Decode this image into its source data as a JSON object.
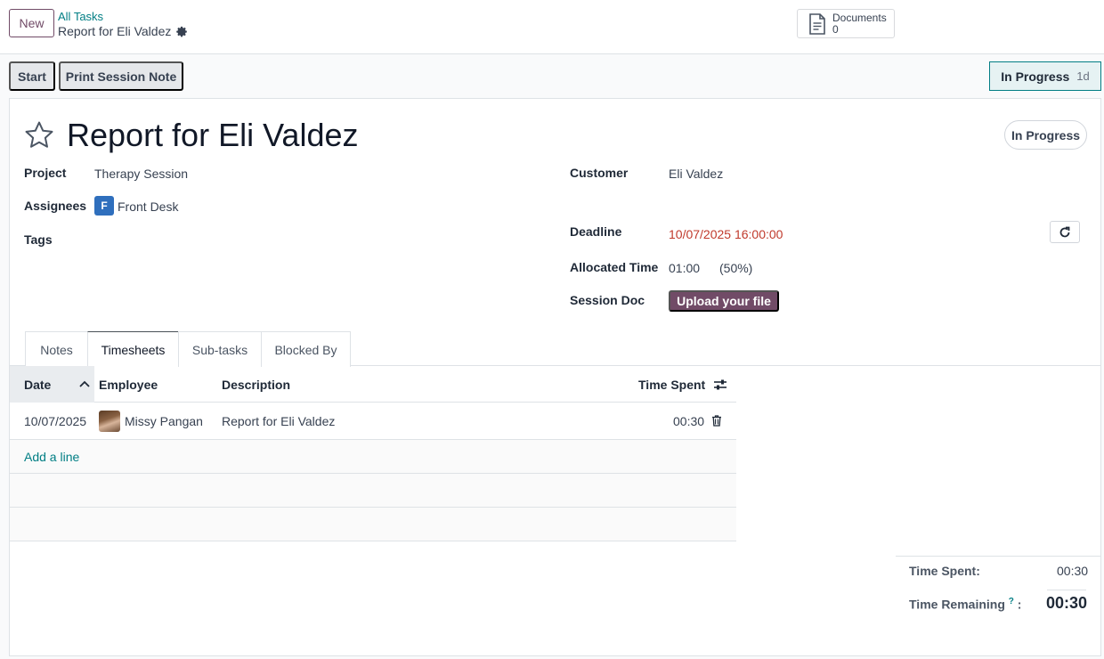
{
  "control_panel": {
    "new_label": "New",
    "breadcrumb_parent": "All Tasks",
    "breadcrumb_current": "Report for Eli Valdez",
    "documents_label": "Documents",
    "documents_count": "0"
  },
  "status_bar": {
    "start_label": "Start",
    "print_label": "Print Session Note",
    "stage_label": "In Progress",
    "stage_duration": "1d"
  },
  "form": {
    "title": "Report for Eli Valdez",
    "state_pill": "In Progress",
    "fields": {
      "project_label": "Project",
      "project_value": "Therapy Session",
      "assignees_label": "Assignees",
      "assignee_initial": "F",
      "assignee_value": "Front Desk",
      "tags_label": "Tags",
      "customer_label": "Customer",
      "customer_value": "Eli Valdez",
      "deadline_label": "Deadline",
      "deadline_value": "10/07/2025 16:00:00",
      "allocated_label": "Allocated Time",
      "allocated_value": "01:00",
      "allocated_percent": "(50%)",
      "session_doc_label": "Session Doc",
      "upload_label": "Upload your file"
    }
  },
  "tabs": [
    {
      "label": "Notes"
    },
    {
      "label": "Timesheets"
    },
    {
      "label": "Sub-tasks"
    },
    {
      "label": "Blocked By"
    }
  ],
  "timesheets": {
    "columns": {
      "date": "Date",
      "employee": "Employee",
      "description": "Description",
      "time_spent": "Time Spent"
    },
    "rows": [
      {
        "date": "10/07/2025",
        "employee": "Missy Pangan",
        "description": "Report for Eli Valdez",
        "time_spent": "00:30"
      }
    ],
    "add_line": "Add a line"
  },
  "totals": {
    "time_spent_label": "Time Spent:",
    "time_spent_value": "00:30",
    "remaining_label": "Time Remaining",
    "remaining_help": "?",
    "remaining_colon": ":",
    "remaining_value": "00:30"
  },
  "colors": {
    "brand": "#714b67",
    "link": "#017e84",
    "deadline": "#c0392b"
  }
}
